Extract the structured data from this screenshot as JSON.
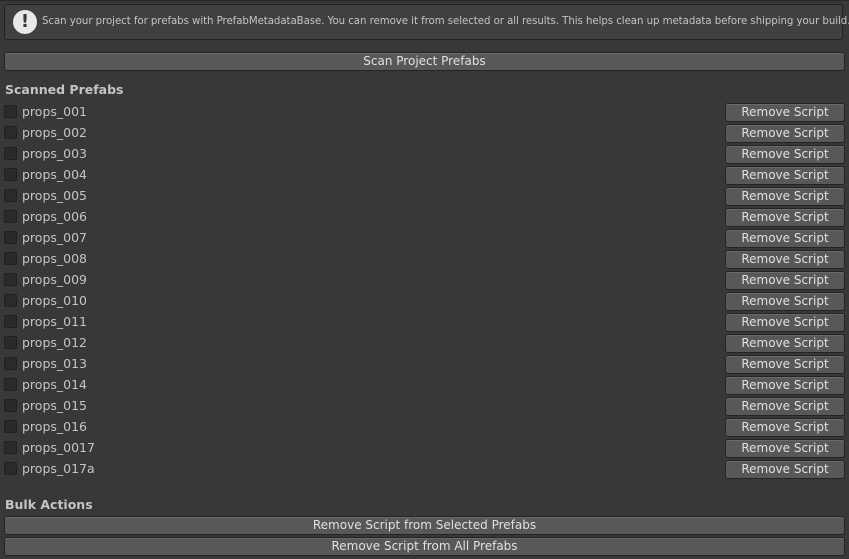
{
  "help": {
    "icon": "exclamation-icon",
    "text": "Scan your project for prefabs with PrefabMetadataBase. You can remove it from selected or all results. This helps clean up metadata before shipping your build."
  },
  "scan_button_label": "Scan Project Prefabs",
  "scanned_title": "Scanned Prefabs",
  "prefabs": [
    {
      "name": "props_001",
      "checked": false,
      "button": "Remove Script"
    },
    {
      "name": "props_002",
      "checked": false,
      "button": "Remove Script"
    },
    {
      "name": "props_003",
      "checked": false,
      "button": "Remove Script"
    },
    {
      "name": "props_004",
      "checked": false,
      "button": "Remove Script"
    },
    {
      "name": "props_005",
      "checked": false,
      "button": "Remove Script"
    },
    {
      "name": "props_006",
      "checked": false,
      "button": "Remove Script"
    },
    {
      "name": "props_007",
      "checked": false,
      "button": "Remove Script"
    },
    {
      "name": "props_008",
      "checked": false,
      "button": "Remove Script"
    },
    {
      "name": "props_009",
      "checked": false,
      "button": "Remove Script"
    },
    {
      "name": "props_010",
      "checked": false,
      "button": "Remove Script"
    },
    {
      "name": "props_011",
      "checked": false,
      "button": "Remove Script"
    },
    {
      "name": "props_012",
      "checked": false,
      "button": "Remove Script"
    },
    {
      "name": "props_013",
      "checked": false,
      "button": "Remove Script"
    },
    {
      "name": "props_014",
      "checked": false,
      "button": "Remove Script"
    },
    {
      "name": "props_015",
      "checked": false,
      "button": "Remove Script"
    },
    {
      "name": "props_016",
      "checked": false,
      "button": "Remove Script"
    },
    {
      "name": "props_0017",
      "checked": false,
      "button": "Remove Script"
    },
    {
      "name": "props_017a",
      "checked": false,
      "button": "Remove Script"
    }
  ],
  "bulk_title": "Bulk Actions",
  "bulk": {
    "selected_label": "Remove Script from Selected Prefabs",
    "all_label": "Remove Script from All Prefabs"
  }
}
